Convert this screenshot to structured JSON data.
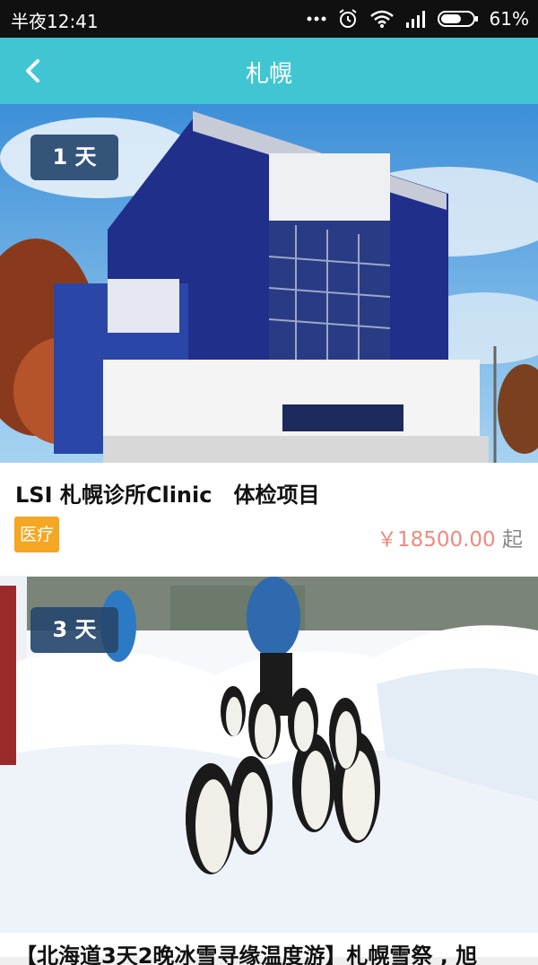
{
  "status_bar": {
    "time": "半夜12:41",
    "battery": "61%",
    "icons": [
      "more-dots-icon",
      "alarm-icon",
      "wifi-icon",
      "signal-icon",
      "battery-icon"
    ]
  },
  "header": {
    "title": "札幌",
    "back_icon": "chevron-left-icon",
    "background": "#40c6d2"
  },
  "products": [
    {
      "days": "1 天",
      "title": "LSI 札幌诊所Clinic　体检项目",
      "tag": "医疗",
      "price": "￥18500.00",
      "price_suffix": "起",
      "image": "clinic-building-photo"
    },
    {
      "days": "3 天",
      "title": "【北海道3天2晚冰雪寻缘温度游】札幌雪祭 , 旭",
      "image": "penguin-parade-photo"
    }
  ],
  "colors": {
    "tag_bg": "#f5a623",
    "price": "#f08a7e",
    "badge_bg": "#26486e"
  }
}
